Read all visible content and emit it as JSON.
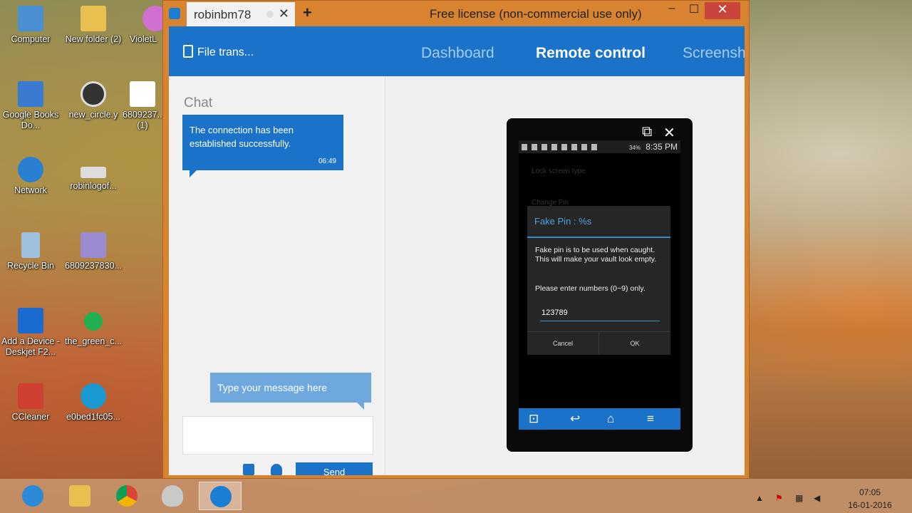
{
  "desktop": {
    "icons": [
      {
        "label": "Computer",
        "color": "#4a90d0"
      },
      {
        "label": "New folder (2)",
        "color": "#e8c050"
      },
      {
        "label": "VioletL",
        "color": "#d070d0"
      },
      {
        "label": "Google Books Do...",
        "color": "#3a7ad0"
      },
      {
        "label": "new_circle.y",
        "color": "#333333"
      },
      {
        "label": "6809237... (1)",
        "color": "#ffffff"
      },
      {
        "label": "Network",
        "color": "#2a80d0"
      },
      {
        "label": "robinlogof...",
        "color": "#dddddd"
      },
      {
        "label": "Recycle Bin",
        "color": "#a0c0e0"
      },
      {
        "label": "6809237830...",
        "color": "#9a8ad0"
      },
      {
        "label": "Add a Device - Deskjet F2...",
        "color": "#1a6ad0"
      },
      {
        "label": "the_green_c...",
        "color": "#20b050"
      },
      {
        "label": "CCleaner",
        "color": "#d04030"
      },
      {
        "label": "e0bed1fc05...",
        "color": "#1a9ad0"
      }
    ]
  },
  "window": {
    "tab_title": "robinbm78",
    "new_tab": "+",
    "license": "Free license (non-commercial use only)",
    "minimize": "–",
    "maximize": "☐",
    "close": "✕",
    "tab_close": "✕"
  },
  "nav": {
    "file_transfer": "File trans...",
    "items": [
      "Dashboard",
      "Remote control",
      "Screensh"
    ],
    "active": "Remote control"
  },
  "chat": {
    "title": "Chat",
    "message": "The connection has been established successfully.",
    "time": "06:49",
    "placeholder": "Type your message here",
    "send": "Send"
  },
  "phone": {
    "status_battery": "34%",
    "status_time": "8:35 PM",
    "bg_item1": "Lock screen type",
    "bg_item2": "Change Pin",
    "dialog": {
      "title": "Fake Pin : %s",
      "desc": "Fake pin is to be used when caught. This will make your vault look empty.",
      "hint": "Please enter numbers (0~9) only.",
      "value": "123789",
      "cancel": "Cancel",
      "ok": "OK"
    }
  },
  "taskbar": {
    "apps": [
      "internet-explorer",
      "file-explorer",
      "chrome",
      "paint",
      "teamviewer"
    ],
    "clock_time": "07:05",
    "clock_date": "16-01-2016"
  }
}
